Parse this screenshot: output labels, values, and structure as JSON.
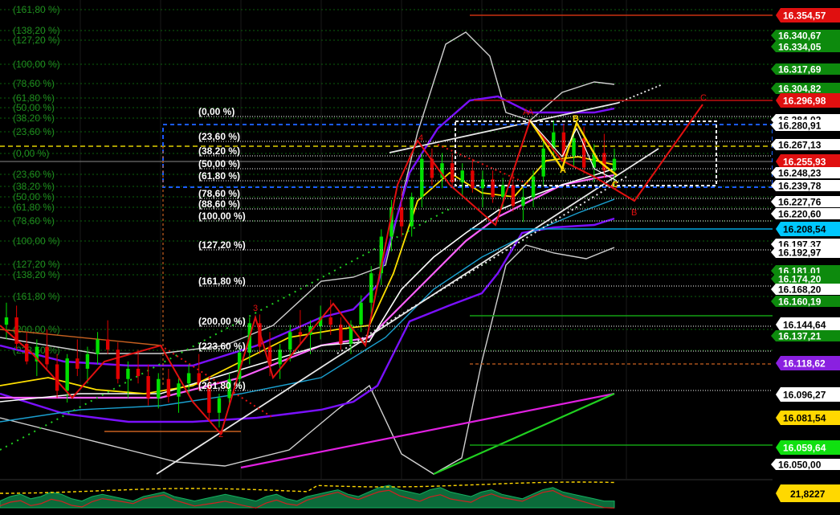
{
  "chart_data": {
    "type": "candlestick",
    "price_axis": {
      "ylim": [
        16040,
        16364
      ],
      "labels": [
        {
          "value": "16.354,57",
          "bg": "#e01010",
          "fg": "#ffffff"
        },
        {
          "value": "16.340,67",
          "bg": "#0d8a0d",
          "fg": "#ffffff"
        },
        {
          "value": "16.334,05",
          "bg": "#0d8a0d",
          "fg": "#ffffff"
        },
        {
          "value": "16.317,69",
          "bg": "#0d8a0d",
          "fg": "#ffffff"
        },
        {
          "value": "16.304,82",
          "bg": "#0d8a0d",
          "fg": "#ffffff"
        },
        {
          "value": "16.296,98",
          "bg": "#e01010",
          "fg": "#ffffff"
        },
        {
          "value": "16.284,02",
          "bg": "#ffffff",
          "fg": "#000000"
        },
        {
          "value": "16.280,91",
          "bg": "#ffffff",
          "fg": "#000000"
        },
        {
          "value": "16.267,13",
          "bg": "#ffffff",
          "fg": "#000000"
        },
        {
          "value": "16.255,93",
          "bg": "#e01010",
          "fg": "#ffffff"
        },
        {
          "value": "16.248,23",
          "bg": "#ffffff",
          "fg": "#000000"
        },
        {
          "value": "16.239,78",
          "bg": "#ffffff",
          "fg": "#000000"
        },
        {
          "value": "16.227,76",
          "bg": "#ffffff",
          "fg": "#000000"
        },
        {
          "value": "16.220,60",
          "bg": "#ffffff",
          "fg": "#000000"
        },
        {
          "value": "16.208,54",
          "bg": "#00c8ff",
          "fg": "#000000"
        },
        {
          "value": "16.197,37",
          "bg": "#ffffff",
          "fg": "#000000"
        },
        {
          "value": "16.192,97",
          "bg": "#ffffff",
          "fg": "#000000"
        },
        {
          "value": "16.181,01",
          "bg": "#0d8a0d",
          "fg": "#ffffff"
        },
        {
          "value": "16.174,20",
          "bg": "#0d8a0d",
          "fg": "#ffffff"
        },
        {
          "value": "16.168,20",
          "bg": "#ffffff",
          "fg": "#000000"
        },
        {
          "value": "16.160,19",
          "bg": "#0d8a0d",
          "fg": "#ffffff"
        },
        {
          "value": "16.144,64",
          "bg": "#ffffff",
          "fg": "#000000"
        },
        {
          "value": "16.137,21",
          "bg": "#0d8a0d",
          "fg": "#ffffff"
        },
        {
          "value": "16.118,62",
          "bg": "#8a20e0",
          "fg": "#ffffff"
        },
        {
          "value": "16.096,27",
          "bg": "#ffffff",
          "fg": "#000000"
        },
        {
          "value": "16.081,54",
          "bg": "#ffd800",
          "fg": "#000000"
        },
        {
          "value": "16.059,64",
          "bg": "#10e010",
          "fg": "#ffffff"
        },
        {
          "value": "16.050,00",
          "bg": "#ffffff",
          "fg": "#000000"
        }
      ],
      "indicator_label": {
        "value": "21,8227",
        "bg": "#ffd800",
        "fg": "#000000"
      }
    },
    "fib_right": [
      "(0,00 %)",
      "(23,60 %)",
      "(38,20 %)",
      "(50,00 %)",
      "(61,80 %)",
      "(78,60 %)",
      "(88,60 %)",
      "(100,00 %)",
      "(127,20 %)",
      "(161,80 %)",
      "(200,00 %)",
      "(223,60 %)",
      "(261,80 %)"
    ],
    "fib_left": [
      "(161,80 %)",
      "(138,20 %)",
      "(127,20 %)",
      "(100,00 %)",
      "(78,60 %)",
      "(61,80 %)",
      "(50,00 %)",
      "(38,20 %)",
      "(23,60 %)",
      "(0,00 %)",
      "(23,60 %)",
      "(38,20 %)",
      "(50,00 %)",
      "(61,80 %)",
      "(78,60 %)",
      "(100,00 %)",
      "(127,20 %)",
      "(138,20 %)",
      "(161,80 %)",
      "(200,00 %)",
      "(223,60 %)"
    ],
    "waves": {
      "impulse": [
        "2",
        "3",
        "4",
        "A",
        "C"
      ],
      "abc_red": [
        "A",
        "B",
        "C"
      ],
      "abc_yellow": [
        "A",
        "B",
        "C"
      ]
    },
    "candles": [
      [
        16145,
        16160,
        16135,
        16150
      ],
      [
        16150,
        16158,
        16128,
        16132
      ],
      [
        16132,
        16140,
        16118,
        16120
      ],
      [
        16120,
        16135,
        16110,
        16130
      ],
      [
        16130,
        16142,
        16115,
        16118
      ],
      [
        16118,
        16125,
        16095,
        16100
      ],
      [
        16100,
        16125,
        16092,
        16122
      ],
      [
        16122,
        16135,
        16110,
        16115
      ],
      [
        16115,
        16130,
        16105,
        16125
      ],
      [
        16125,
        16140,
        16118,
        16135
      ],
      [
        16135,
        16148,
        16125,
        16128
      ],
      [
        16128,
        16133,
        16105,
        16108
      ],
      [
        16108,
        16120,
        16095,
        16115
      ],
      [
        16115,
        16128,
        16105,
        16110
      ],
      [
        16110,
        16118,
        16090,
        16095
      ],
      [
        16095,
        16112,
        16088,
        16108
      ],
      [
        16108,
        16115,
        16092,
        16096
      ],
      [
        16096,
        16110,
        16085,
        16105
      ],
      [
        16105,
        16118,
        16098,
        16112
      ],
      [
        16112,
        16125,
        16100,
        16104
      ],
      [
        16104,
        16110,
        16080,
        16085
      ],
      [
        16085,
        16098,
        16075,
        16095
      ],
      [
        16095,
        16112,
        16090,
        16108
      ],
      [
        16108,
        16130,
        16102,
        16126
      ],
      [
        16126,
        16150,
        16118,
        16146
      ],
      [
        16146,
        16152,
        16125,
        16130
      ],
      [
        16130,
        16140,
        16110,
        16118
      ],
      [
        16118,
        16132,
        16108,
        16128
      ],
      [
        16128,
        16145,
        16120,
        16140
      ],
      [
        16140,
        16155,
        16132,
        16138
      ],
      [
        16138,
        16148,
        16125,
        16144
      ],
      [
        16144,
        16158,
        16135,
        16150
      ],
      [
        16150,
        16162,
        16138,
        16145
      ],
      [
        16145,
        16150,
        16128,
        16132
      ],
      [
        16132,
        16148,
        16125,
        16145
      ],
      [
        16145,
        16165,
        16140,
        16160
      ],
      [
        16160,
        16185,
        16152,
        16180
      ],
      [
        16180,
        16210,
        16172,
        16205
      ],
      [
        16205,
        16230,
        16195,
        16225
      ],
      [
        16225,
        16240,
        16205,
        16212
      ],
      [
        16212,
        16235,
        16205,
        16232
      ],
      [
        16232,
        16262,
        16225,
        16258
      ],
      [
        16258,
        16265,
        16240,
        16245
      ],
      [
        16245,
        16262,
        16238,
        16255
      ],
      [
        16255,
        16262,
        16238,
        16242
      ],
      [
        16242,
        16255,
        16232,
        16250
      ],
      [
        16250,
        16258,
        16235,
        16238
      ],
      [
        16238,
        16250,
        16225,
        16244
      ],
      [
        16244,
        16250,
        16228,
        16232
      ],
      [
        16232,
        16245,
        16225,
        16240
      ],
      [
        16240,
        16248,
        16222,
        16226
      ],
      [
        16226,
        16238,
        16215,
        16232
      ],
      [
        16232,
        16250,
        16225,
        16246
      ],
      [
        16246,
        16270,
        16240,
        16265
      ],
      [
        16265,
        16284,
        16258,
        16276
      ],
      [
        16276,
        16282,
        16255,
        16260
      ],
      [
        16260,
        16278,
        16252,
        16272
      ],
      [
        16272,
        16280,
        16248,
        16252
      ],
      [
        16252,
        16268,
        16242,
        16262
      ],
      [
        16262,
        16275,
        16245,
        16250
      ],
      [
        16250,
        16265,
        16240,
        16258
      ]
    ],
    "volume_indicator": [
      0.3,
      0.5,
      0.6,
      0.4,
      0.5,
      0.7,
      0.6,
      0.4,
      0.3,
      0.5,
      0.6,
      0.5,
      0.4,
      0.3,
      0.5,
      0.6,
      0.7,
      0.5,
      0.4,
      0.3,
      0.4,
      0.5,
      0.6,
      0.5,
      0.4,
      0.3,
      0.5,
      0.6,
      0.4,
      0.3,
      0.5,
      0.6,
      0.7,
      0.8,
      0.6,
      0.5,
      0.7,
      0.9,
      1.0,
      0.8,
      0.7,
      0.6,
      0.8,
      0.9,
      0.7,
      0.6,
      0.5,
      0.7,
      0.8,
      0.6,
      0.5,
      0.4,
      0.6,
      0.8,
      0.9,
      0.7,
      0.6,
      0.5,
      0.4,
      0.3,
      0.3
    ],
    "colors": {
      "bg": "#000000",
      "bull": "#00e000",
      "bear": "#e00000",
      "wick_bull": "#00e000",
      "wick_bear": "#e00000",
      "fib_line": "#cccccc",
      "bb_outer": "#d0d0d0",
      "bb_inner": "#7a10ff",
      "ma_yellow": "#ffe000",
      "ma_pink": "#ff60ff",
      "ma_white": "#ffffff",
      "ma_cyan": "#1aa0d0",
      "wave_red": "#e01010",
      "abc_yellow": "#ffd800",
      "box_blue": "#1a5aff",
      "trend_magenta": "#e020e0",
      "trend_green": "#20d020"
    }
  }
}
